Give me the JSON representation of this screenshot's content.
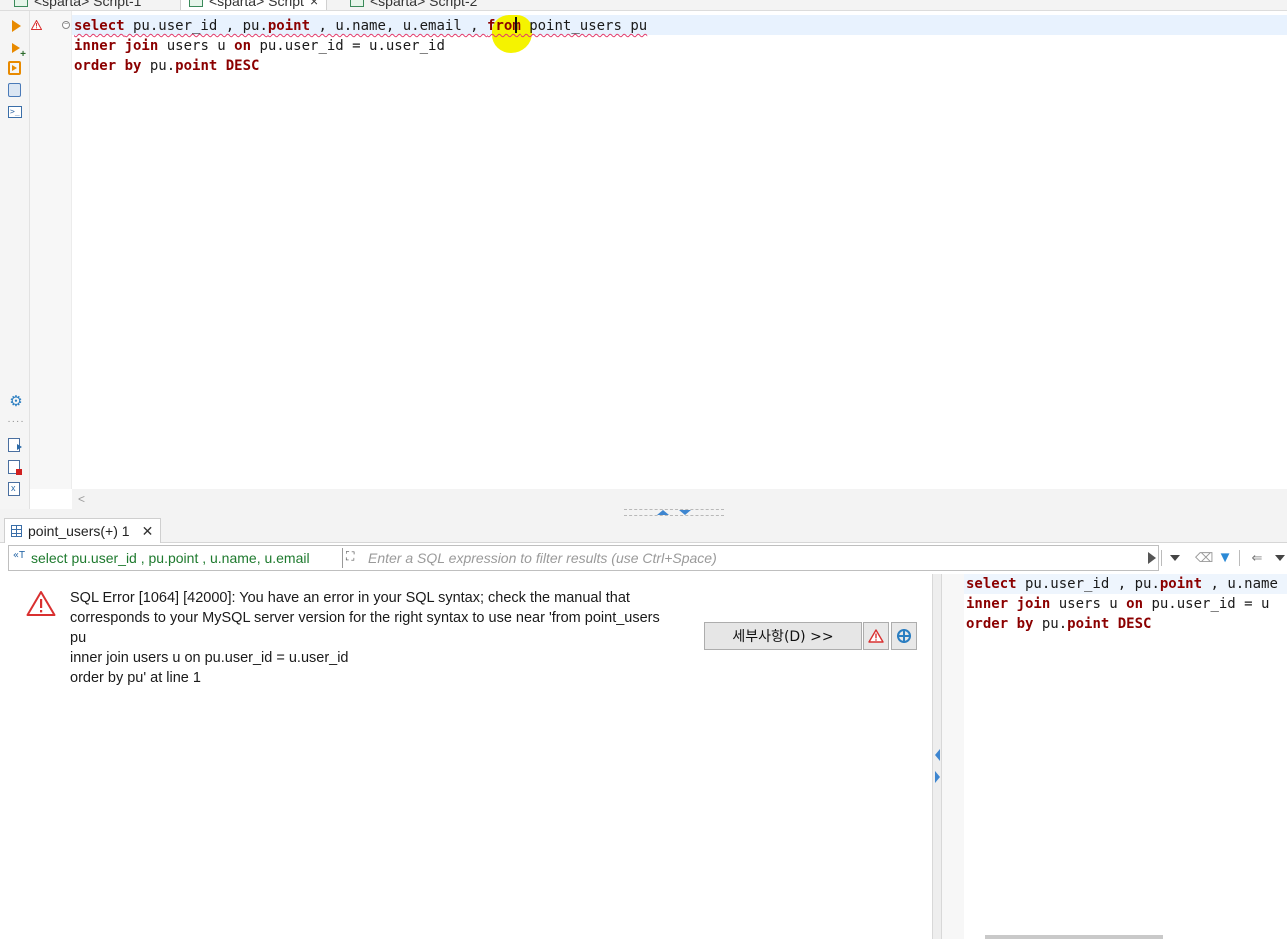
{
  "editor_tabs": [
    {
      "label": "<sparta> Script-1"
    },
    {
      "label": "<sparta> Script"
    },
    {
      "label": "<sparta> Script-2"
    }
  ],
  "editor": {
    "lines": [
      [
        {
          "t": "select",
          "k": "kw"
        },
        {
          "t": " pu.user_id , pu.",
          "k": "id"
        },
        {
          "t": "point",
          "k": "kw"
        },
        {
          "t": " , u.name, u.email , ",
          "k": "id"
        },
        {
          "t": "from",
          "k": "kw"
        },
        {
          "t": " point_users pu",
          "k": "id"
        }
      ],
      [
        {
          "t": "inner join",
          "k": "kw"
        },
        {
          "t": " users u ",
          "k": "id"
        },
        {
          "t": "on",
          "k": "kw"
        },
        {
          "t": " pu.user_id = u.user_id",
          "k": "id"
        }
      ],
      [
        {
          "t": "order by",
          "k": "kw"
        },
        {
          "t": " pu.",
          "k": "id"
        },
        {
          "t": "point DESC",
          "k": "kw"
        }
      ]
    ]
  },
  "results": {
    "tab_label": "point_users(+) 1",
    "query_preview": "select pu.user_id , pu.point , u.name, u.email",
    "filter_placeholder": "Enter a SQL expression to filter results (use Ctrl+Space)"
  },
  "error": {
    "lines": [
      "SQL Error [1064] [42000]: You have an error in your SQL syntax; check the manual that",
      "corresponds to your MySQL server version for the right syntax to use near 'from point_users",
      "pu",
      "inner join users u on pu.user_id = u.user_id",
      "order by pu' at line 1"
    ],
    "details_button": "세부사항(D) >>"
  },
  "query_panel": {
    "lines": [
      [
        {
          "t": "select",
          "k": "kw"
        },
        {
          "t": " pu.user_id , pu.",
          "k": "id"
        },
        {
          "t": "point",
          "k": "kw"
        },
        {
          "t": " , u.name",
          "k": "id"
        }
      ],
      [
        {
          "t": "inner join",
          "k": "kw"
        },
        {
          "t": " users u ",
          "k": "id"
        },
        {
          "t": "on",
          "k": "kw"
        },
        {
          "t": " pu.user_id = u",
          "k": "id"
        }
      ],
      [
        {
          "t": "order by",
          "k": "kw"
        },
        {
          "t": " pu.",
          "k": "id"
        },
        {
          "t": "point DESC",
          "k": "kw"
        }
      ]
    ]
  },
  "colors": {
    "keyword": "#8b0000",
    "query_text_green": "#1e7a2e",
    "highlight_yellow": "#f5f300",
    "accent_blue": "#3e86d0",
    "error_red": "#d93030"
  },
  "icons": [
    "run-icon",
    "run-new-tab-icon",
    "execute-script-icon",
    "explain-plan-icon",
    "console-icon",
    "settings-gear-icon",
    "export-icon",
    "stop-icon",
    "xml-icon",
    "error-triangle-icon",
    "filter-icon",
    "eraser-icon",
    "back-arrow-icon",
    "target-icon"
  ]
}
